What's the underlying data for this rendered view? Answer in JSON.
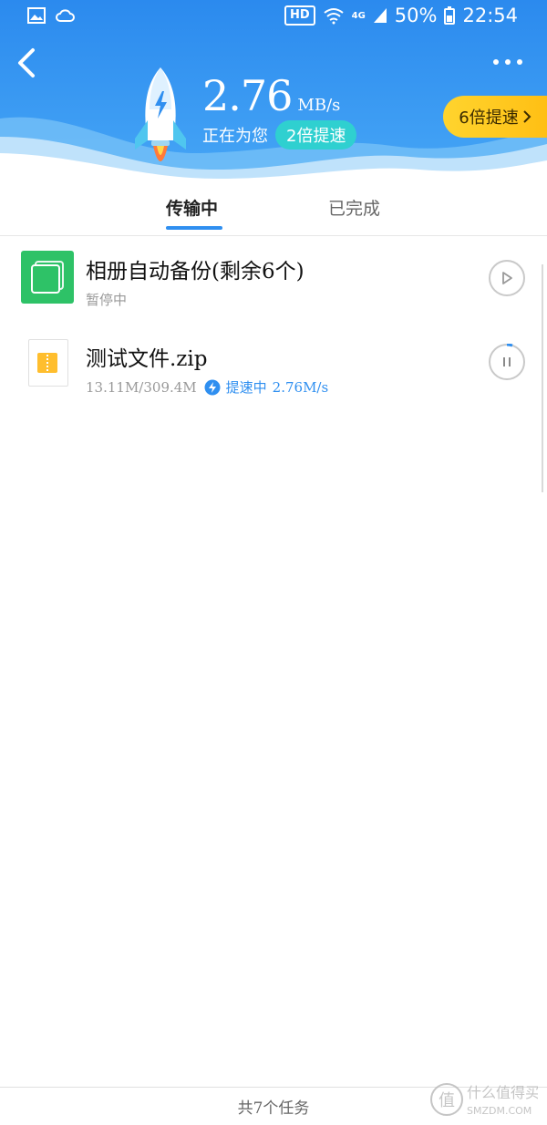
{
  "status_bar": {
    "hd": "HD",
    "network": "4G",
    "battery": "50%",
    "time": "22:54",
    "icons": [
      "image-icon",
      "cloud-icon",
      "wifi-icon",
      "signal-icon",
      "battery-icon"
    ]
  },
  "header": {
    "speed_value": "2.76",
    "speed_unit": "MB/s",
    "status_text": "正在为您",
    "boost_badge": "2倍提速",
    "boost_button": "6倍提速",
    "colors": {
      "header_bg": "#2f8ff0",
      "accent": "#2fd0d0",
      "gold": "#ffc61e"
    }
  },
  "tabs": [
    {
      "label": "传输中",
      "active": true
    },
    {
      "label": "已完成",
      "active": false
    }
  ],
  "items": [
    {
      "title": "相册自动备份(剩余6个)",
      "status": "暂停中",
      "icon": "album-icon",
      "control": "play-icon"
    },
    {
      "title": "测试文件.zip",
      "progress": "13.11M/309.4M",
      "boost_label": "提速中",
      "boost_speed": "2.76M/s",
      "icon": "zip-icon",
      "control": "pause-icon"
    }
  ],
  "footer": {
    "summary": "共7个任务"
  },
  "watermark": {
    "main": "什么值得买",
    "sub": "SMZDM.COM",
    "logo_char": "值"
  }
}
